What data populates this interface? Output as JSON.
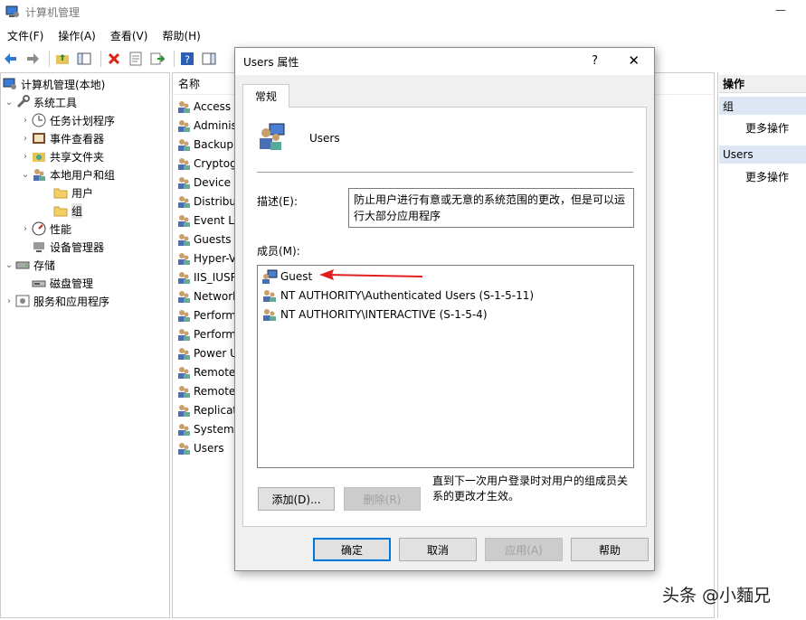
{
  "window": {
    "title": "计算机管理"
  },
  "menu": [
    "文件(F)",
    "操作(A)",
    "查看(V)",
    "帮助(H)"
  ],
  "toolbar_icons": [
    "back-icon",
    "forward-icon",
    "up-folder-icon",
    "show-tree-icon",
    "delete-icon",
    "properties-icon",
    "export-icon",
    "help-icon",
    "show-action-pane-icon"
  ],
  "tree": [
    {
      "label": "计算机管理(本地)",
      "icon": "computer-management-icon",
      "expander": ""
    },
    {
      "label": "系统工具",
      "icon": "tools-icon",
      "expander": "v"
    },
    {
      "label": "任务计划程序",
      "icon": "clock-icon",
      "expander": ">"
    },
    {
      "label": "事件查看器",
      "icon": "event-viewer-icon",
      "expander": ">"
    },
    {
      "label": "共享文件夹",
      "icon": "shared-folder-icon",
      "expander": ">"
    },
    {
      "label": "本地用户和组",
      "icon": "users-icon",
      "expander": "v"
    },
    {
      "label": "用户",
      "icon": "folder-icon",
      "expander": ""
    },
    {
      "label": "组",
      "icon": "folder-icon",
      "expander": ""
    },
    {
      "label": "性能",
      "icon": "performance-icon",
      "expander": ">"
    },
    {
      "label": "设备管理器",
      "icon": "device-manager-icon",
      "expander": ""
    },
    {
      "label": "存储",
      "icon": "storage-icon",
      "expander": "v"
    },
    {
      "label": "磁盘管理",
      "icon": "disk-icon",
      "expander": ""
    },
    {
      "label": "服务和应用程序",
      "icon": "services-icon",
      "expander": ">"
    }
  ],
  "list": {
    "header": "名称",
    "items": [
      "Access C",
      "Adminis",
      "Backup",
      "Cryptog",
      "Device C",
      "Distribu",
      "Event Lo",
      "Guests",
      "Hyper-V",
      "IIS_IUSR",
      "Network",
      "Perform",
      "Perform",
      "Power U",
      "Remote",
      "Remote",
      "Replicat",
      "System",
      "Users"
    ]
  },
  "actions": {
    "header": "操作",
    "section1": "组",
    "link1": "更多操作",
    "section2": "Users",
    "link2": "更多操作"
  },
  "dialog": {
    "title": "Users 属性",
    "help": "?",
    "close": "✕",
    "tab": "常规",
    "group_name": "Users",
    "desc_label": "描述(E):",
    "description": "防止用户进行有意或无意的系统范围的更改，但是可以运行大部分应用程序",
    "members_label": "成员(M):",
    "members": [
      "Guest",
      "NT AUTHORITY\\Authenticated Users (S-1-5-11)",
      "NT AUTHORITY\\INTERACTIVE (S-1-5-4)"
    ],
    "add_button": "添加(D)...",
    "remove_button": "删除(R)",
    "note": "直到下一次用户登录时对用户的组成员关系的更改才生效。",
    "ok": "确定",
    "cancel": "取消",
    "apply": "应用(A)",
    "help_button": "帮助"
  },
  "watermark": "头条 @小麵兄",
  "colors": {
    "accent": "#0078d7",
    "arrow": "#e02020",
    "selection": "#dde8f4"
  }
}
